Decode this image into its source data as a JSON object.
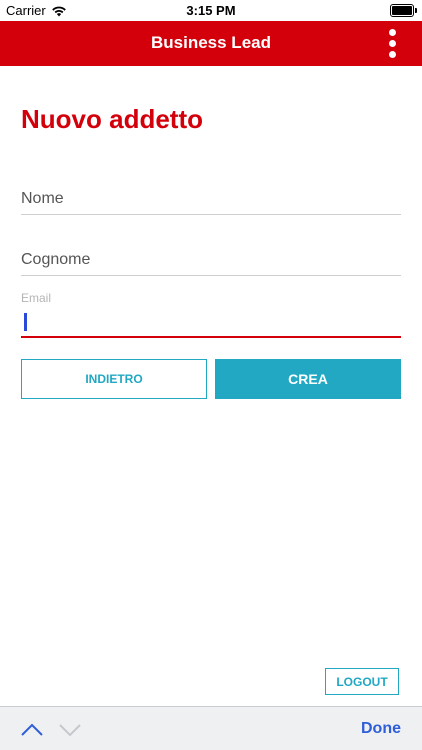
{
  "status_bar": {
    "carrier": "Carrier",
    "time": "3:15 PM"
  },
  "nav": {
    "title": "Business Lead",
    "more_icon": "more-vertical-icon"
  },
  "page": {
    "title": "Nuovo addetto"
  },
  "form": {
    "nome": {
      "placeholder": "Nome",
      "value": ""
    },
    "cognome": {
      "placeholder": "Cognome",
      "value": ""
    },
    "email": {
      "label": "Email",
      "value": ""
    }
  },
  "buttons": {
    "back": "INDIETRO",
    "create": "CREA",
    "logout": "LOGOUT"
  },
  "keyboard_toolbar": {
    "prev_icon": "chevron-up-icon",
    "next_icon": "chevron-down-icon",
    "done": "Done"
  },
  "colors": {
    "brand_red": "#d3000b",
    "accent_teal": "#22a8c3",
    "ios_blue": "#2f5fd8"
  }
}
